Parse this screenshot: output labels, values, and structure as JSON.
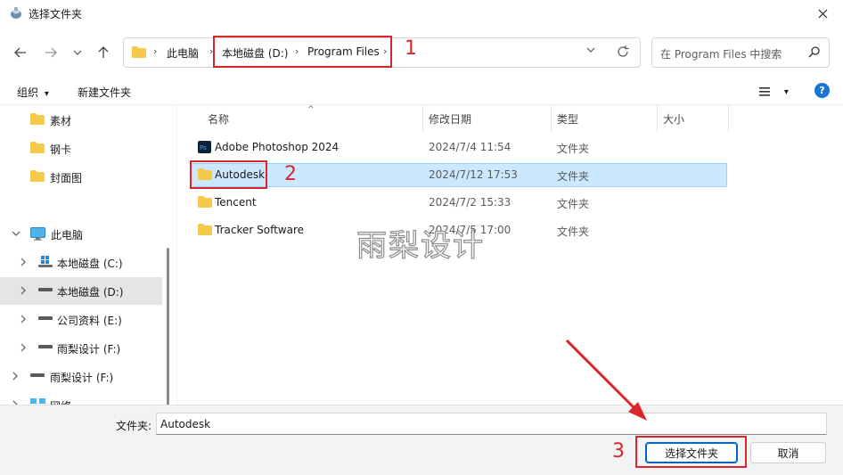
{
  "window": {
    "title": "选择文件夹",
    "close_glyph": "✕"
  },
  "nav": {
    "back": "back-icon",
    "forward": "forward-icon",
    "recent": "chevron-down-icon",
    "up": "up-arrow-icon"
  },
  "address": {
    "items": [
      "此电脑",
      "本地磁盘 (D:)",
      "Program Files"
    ],
    "separator": "›"
  },
  "search": {
    "placeholder": "在 Program Files 中搜索"
  },
  "toolbar": {
    "organize": "组织",
    "organize_caret": "▾",
    "new_folder": "新建文件夹",
    "view_caret": "▾",
    "help": "?"
  },
  "sidebar": {
    "items": [
      {
        "label": "素材",
        "icon": "folder-icon"
      },
      {
        "label": "钢卡",
        "icon": "folder-icon"
      },
      {
        "label": "封面图",
        "icon": "folder-icon"
      },
      {
        "label": "此电脑",
        "icon": "computer-icon",
        "chevron": "⌄"
      },
      {
        "label": "本地磁盘 (C:)",
        "icon": "drive-icon",
        "chevron": "›"
      },
      {
        "label": "本地磁盘 (D:)",
        "icon": "drive-icon",
        "chevron": "›",
        "selected": true
      },
      {
        "label": "公司资料 (E:)",
        "icon": "drive-icon",
        "chevron": "›"
      },
      {
        "label": "雨梨设计 (F:)",
        "icon": "drive-icon",
        "chevron": "›"
      },
      {
        "label": "雨梨设计 (F:)",
        "icon": "drive-icon",
        "chevron": "›"
      },
      {
        "label": "网络",
        "icon": "network-icon",
        "chevron": "›"
      }
    ]
  },
  "list": {
    "columns": [
      "名称",
      "修改日期",
      "类型",
      "大小"
    ],
    "sort_glyph": "^",
    "rows": [
      {
        "name": "Adobe Photoshop 2024",
        "date": "2024/7/4 11:54",
        "type": "文件夹",
        "icon": "photoshop-icon"
      },
      {
        "name": "Autodesk",
        "date": "2024/7/12 17:53",
        "type": "文件夹",
        "icon": "folder-icon",
        "selected": true
      },
      {
        "name": "Tencent",
        "date": "2024/7/2 15:33",
        "type": "文件夹",
        "icon": "folder-icon"
      },
      {
        "name": "Tracker Software",
        "date": "2024/7/5 17:00",
        "type": "文件夹",
        "icon": "folder-icon"
      }
    ]
  },
  "watermark": "雨梨设计",
  "footer": {
    "folder_label": "文件夹:",
    "folder_value": "Autodesk",
    "select_button": "选择文件夹",
    "cancel_button": "取消"
  },
  "annotations": {
    "n1": "1",
    "n2": "2",
    "n3": "3",
    "color": "#d9252b"
  },
  "colors": {
    "selection": "#cce8ff",
    "accent": "#0067c0",
    "folder": "#f6c94a",
    "help": "#1a73d9"
  }
}
